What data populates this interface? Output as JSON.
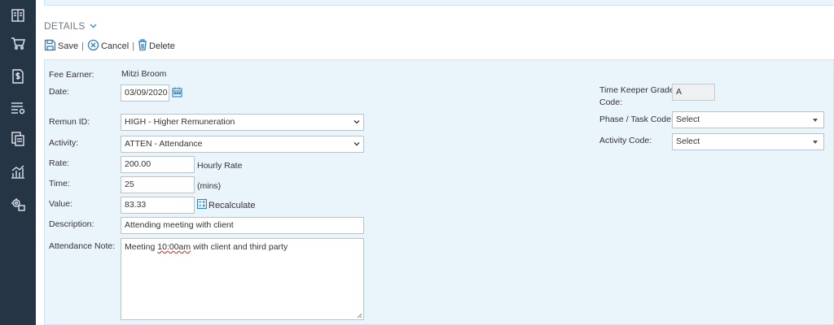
{
  "sidebar": {
    "icons": [
      "book-icon",
      "cart-icon",
      "document-dollar-icon",
      "list-gear-icon",
      "copy-documents-icon",
      "chart-icon",
      "settings-group-icon"
    ]
  },
  "header": {
    "title": "DETAILS",
    "save_label": "Save",
    "cancel_label": "Cancel",
    "delete_label": "Delete",
    "separator": "|"
  },
  "form": {
    "fee_earner_label": "Fee Earner:",
    "fee_earner_value": "Mitzi Broom",
    "date_label": "Date:",
    "date_value": "03/09/2020",
    "remun_label": "Remun ID:",
    "remun_value": "HIGH - Higher Remuneration",
    "activity_label": "Activity:",
    "activity_value": "ATTEN - Attendance",
    "rate_label": "Rate:",
    "rate_value": "200.00",
    "rate_suffix": "Hourly Rate",
    "time_label": "Time:",
    "time_value": "25",
    "time_suffix": "(mins)",
    "value_label": "Value:",
    "value_value": "83.33",
    "recalculate_label": "Recalculate",
    "description_label": "Description:",
    "description_value": "Attending meeting with client",
    "note_label": "Attendance Note:",
    "note_before": "Meeting ",
    "note_error_word": "10:00am",
    "note_after": " with client and third party",
    "tk_grade_label_1": "Time Keeper Grade",
    "tk_grade_label_2": "Code:",
    "tk_grade_value": "A",
    "phase_label": "Phase / Task Code:",
    "phase_value": "Select",
    "activity_code_label": "Activity Code:",
    "activity_code_value": "Select"
  },
  "colors": {
    "sidebar_bg": "#253545",
    "panel_bg": "#eaf4fb",
    "accent": "#3b8fd1"
  }
}
